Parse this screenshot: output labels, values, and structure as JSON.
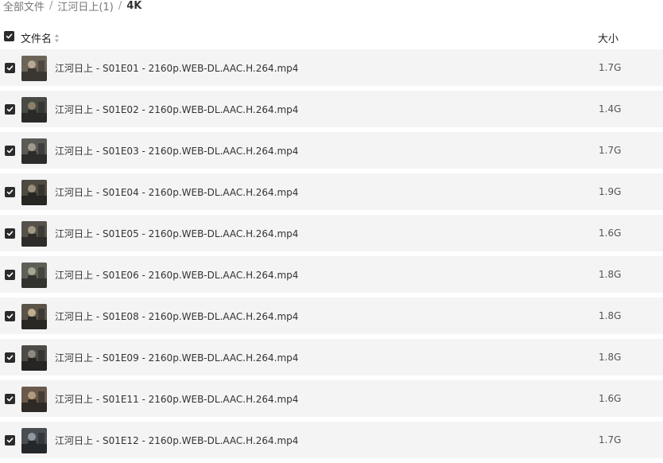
{
  "breadcrumb": {
    "items": [
      "全部文件",
      "江河日上(1)"
    ],
    "separator": "/",
    "current": "4K"
  },
  "table": {
    "header": {
      "name_label": "文件名",
      "size_label": "大小",
      "select_all_checked": true
    },
    "rows": [
      {
        "name": "江河日上 - S01E01 - 2160p.WEB-DL.AAC.H.264.mp4",
        "size": "1.7G",
        "checked": true
      },
      {
        "name": "江河日上 - S01E02 - 2160p.WEB-DL.AAC.H.264.mp4",
        "size": "1.4G",
        "checked": true
      },
      {
        "name": "江河日上 - S01E03 - 2160p.WEB-DL.AAC.H.264.mp4",
        "size": "1.7G",
        "checked": true
      },
      {
        "name": "江河日上 - S01E04 - 2160p.WEB-DL.AAC.H.264.mp4",
        "size": "1.9G",
        "checked": true
      },
      {
        "name": "江河日上 - S01E05 - 2160p.WEB-DL.AAC.H.264.mp4",
        "size": "1.6G",
        "checked": true
      },
      {
        "name": "江河日上 - S01E06 - 2160p.WEB-DL.AAC.H.264.mp4",
        "size": "1.8G",
        "checked": true
      },
      {
        "name": "江河日上 - S01E08 - 2160p.WEB-DL.AAC.H.264.mp4",
        "size": "1.8G",
        "checked": true
      },
      {
        "name": "江河日上 - S01E09 - 2160p.WEB-DL.AAC.H.264.mp4",
        "size": "1.8G",
        "checked": true
      },
      {
        "name": "江河日上 - S01E11 - 2160p.WEB-DL.AAC.H.264.mp4",
        "size": "1.6G",
        "checked": true
      },
      {
        "name": "江河日上 - S01E12 - 2160p.WEB-DL.AAC.H.264.mp4",
        "size": "1.7G",
        "checked": true
      }
    ]
  },
  "colors": {
    "row_bg": "#f4f4f5",
    "checkbox_fill": "#2b2b2b"
  }
}
